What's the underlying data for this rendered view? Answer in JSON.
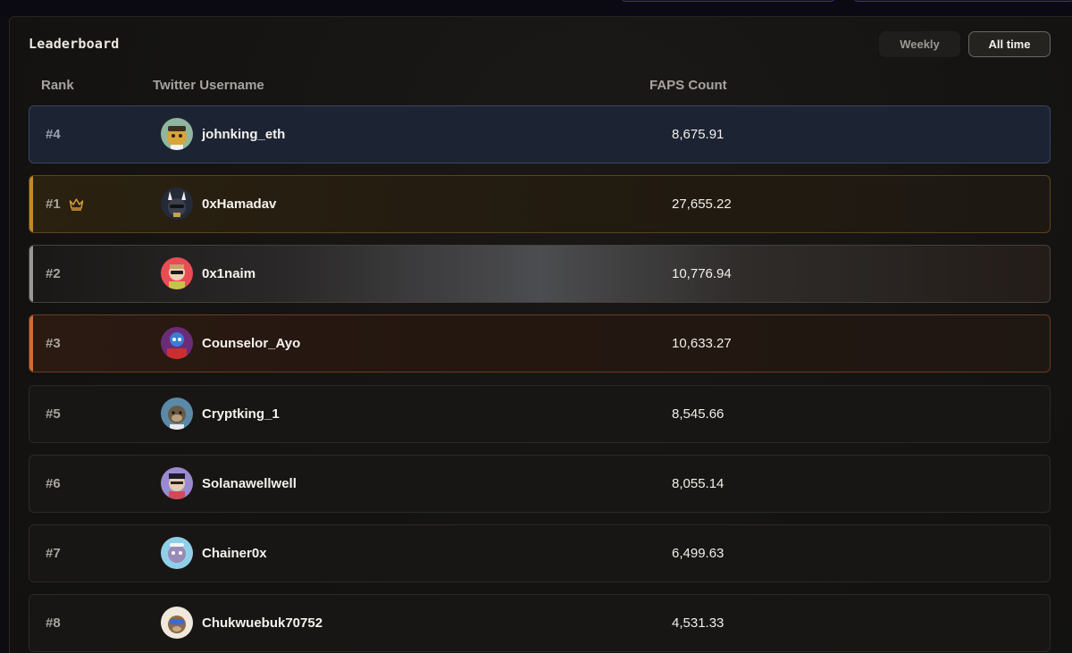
{
  "leaderboard": {
    "title": "Leaderboard",
    "tabs": {
      "weekly": "Weekly",
      "all_time": "All time",
      "active": "All time"
    },
    "columns": {
      "rank": "Rank",
      "username": "Twitter Username",
      "count": "FAPS Count"
    },
    "rows": [
      {
        "rank": "#4",
        "username": "johnking_eth",
        "count": "8,675.91",
        "highlight": "current-user"
      },
      {
        "rank": "#1",
        "username": "0xHamadav",
        "count": "27,655.22",
        "highlight": "gold",
        "icon": "crown-icon"
      },
      {
        "rank": "#2",
        "username": "0x1naim",
        "count": "10,776.94",
        "highlight": "silver"
      },
      {
        "rank": "#3",
        "username": "Counselor_Ayo",
        "count": "10,633.27",
        "highlight": "bronze"
      },
      {
        "rank": "#5",
        "username": "Cryptking_1",
        "count": "8,545.66"
      },
      {
        "rank": "#6",
        "username": "Solanawellwell",
        "count": "8,055.14"
      },
      {
        "rank": "#7",
        "username": "Chainer0x",
        "count": "6,499.63"
      },
      {
        "rank": "#8",
        "username": "Chukwuebuk70752",
        "count": "4,531.33"
      }
    ]
  },
  "colors": {
    "gold": "#c28a28",
    "silver": "#9a9896",
    "bronze": "#d06a36",
    "current_user": "#1c2333"
  }
}
